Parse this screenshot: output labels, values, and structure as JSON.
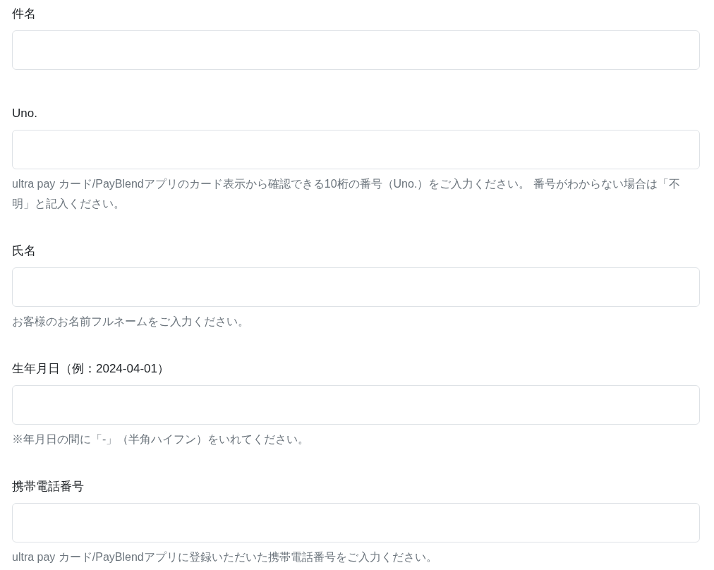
{
  "fields": [
    {
      "label": "件名"
    },
    {
      "label": "Uno.",
      "help": "ultra pay カード/PayBlendアプリのカード表示から確認できる10桁の番号（Uno.）をご入力ください。 番号がわからない場合は「不明」と記入ください。"
    },
    {
      "label": "氏名",
      "help": "お客様のお名前フルネームをご入力ください。"
    },
    {
      "label": "生年月日（例：2024-04-01）",
      "help": "※年月日の間に「-」（半角ハイフン）をいれてください。"
    },
    {
      "label": "携帯電話番号",
      "help": "ultra pay カード/PayBlendアプリに登録いただいた携帯電話番号をご入力ください。"
    }
  ]
}
